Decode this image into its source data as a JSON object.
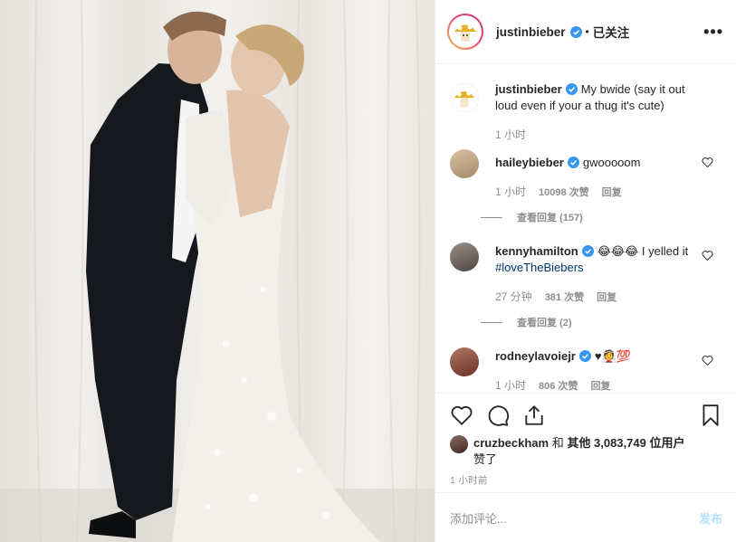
{
  "post": {
    "author": "justinbieber",
    "follow_status": "已关注",
    "more_icon": "more-horizontal-icon"
  },
  "caption": {
    "username": "justinbieber",
    "text": "My bwide (say it out loud even if your a thug it's cute)",
    "time": "1 小时"
  },
  "comments": [
    {
      "username": "haileybieber",
      "text": "gwooooom",
      "time": "1 小时",
      "likes": "10098 次赞",
      "reply": "回复",
      "view_replies": "查看回复 (157)"
    },
    {
      "username": "kennyhamilton",
      "text_before": "😂😂😂 I yelled it ",
      "hashtag": "#loveTheBiebers",
      "time": "27 分钟",
      "likes": "381 次赞",
      "reply": "回复",
      "view_replies": "查看回复 (2)"
    },
    {
      "username": "rodneylavoiejr",
      "text": "♥👰💯",
      "time": "1 小时",
      "likes": "806 次赞",
      "reply": "回复"
    }
  ],
  "likes": {
    "user": "cruzbeckham",
    "connector": "和",
    "others_label": "其他",
    "count": "3,083,749",
    "suffix": "位用户",
    "line2": "赞了"
  },
  "timestamp": "1 小时前",
  "add_comment": {
    "placeholder": "添加评论...",
    "post_button": "发布"
  },
  "colors": {
    "verified": "#3897f0",
    "link": "#00376b",
    "muted": "#8e8e8e",
    "post_disabled": "#b2dffc"
  }
}
